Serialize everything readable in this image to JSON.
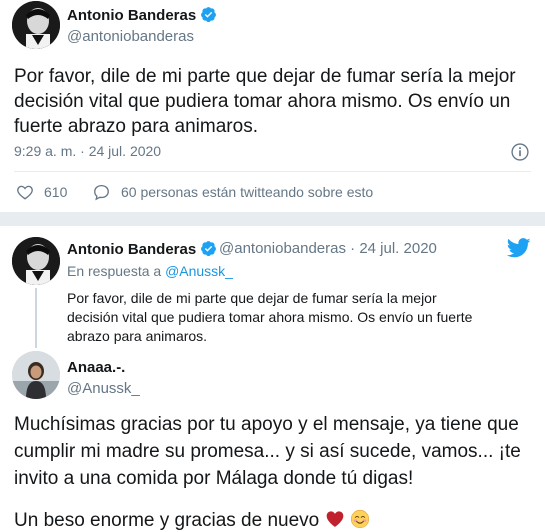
{
  "main_tweet": {
    "author_name": "Antonio Banderas",
    "author_handle": "@antoniobanderas",
    "text": "Por favor, dile de mi parte que dejar de fumar sería la mejor decisión vital que pudiera tomar ahora mismo. Os envío un fuerte abrazo para animaros.",
    "timestamp": "9:29 a. m. · 24 jul. 2020",
    "likes": "610",
    "talking": "60 personas están twitteando sobre esto"
  },
  "reply_thread": {
    "author_name": "Antonio Banderas",
    "author_handle": "@antoniobanderas · 24 jul. 2020",
    "in_reply_prefix": "En respuesta a ",
    "in_reply_handle": "@Anussk_",
    "text": "Por favor, dile de mi parte que dejar de fumar sería la mejor decisión vital que pudiera tomar ahora mismo. Os envío un fuerte abrazo para animaros.",
    "response": {
      "author_name": "Anaaa.-.",
      "author_handle": "@Anussk_",
      "text": "Muchísimas gracias por tu apoyo y el mensaje, ya tiene que cumplir mi madre su promesa... y si así sucede, vamos... ¡te invito a una comida por Málaga donde tú digas!",
      "closing": "Un beso enorme y gracias de nuevo"
    }
  },
  "colors": {
    "verified_blue": "#1da1f2",
    "twitter_blue": "#1da1f2",
    "link_blue": "#1b95e0",
    "muted_gray": "#657786",
    "heart_red": "#c0212c"
  },
  "icons": [
    "verified-badge-icon",
    "info-icon",
    "heart-icon",
    "speech-bubble-icon",
    "twitter-bird-icon",
    "red-heart-emoji",
    "smiling-blush-emoji"
  ]
}
